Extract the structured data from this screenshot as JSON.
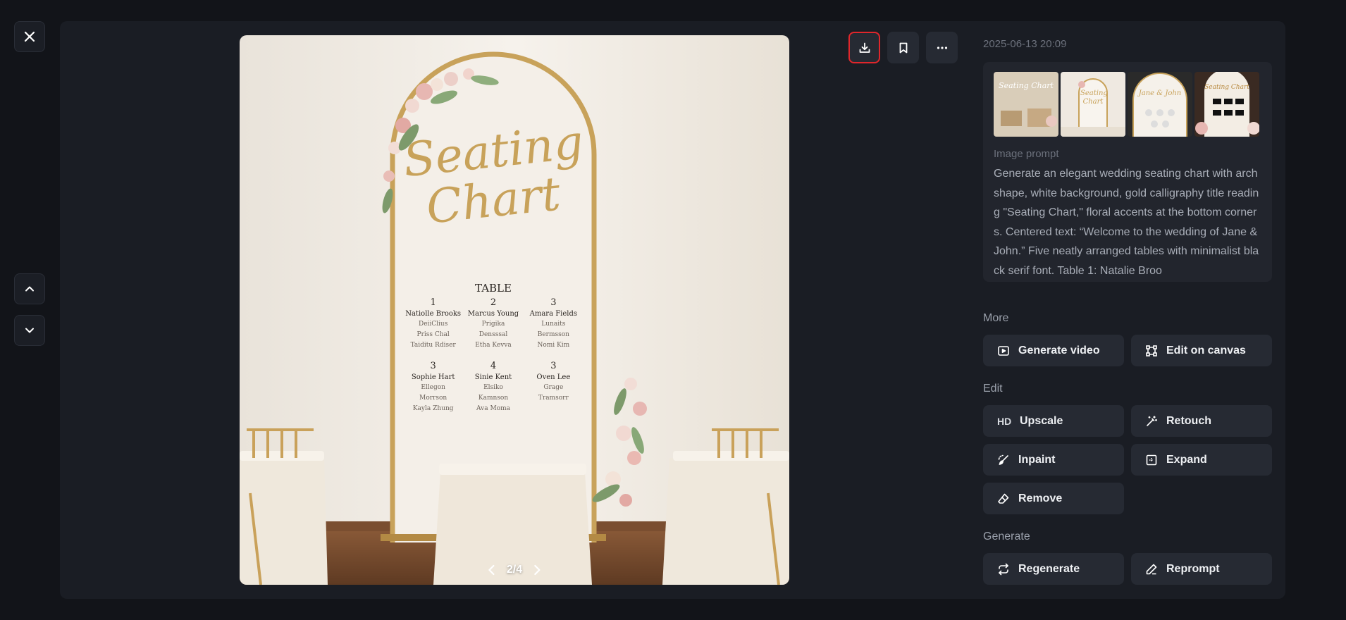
{
  "timestamp": "2025-06-13 20:09",
  "pager": {
    "text": "2/4"
  },
  "image": {
    "title_line1": "Seating",
    "title_line2": "Chart",
    "table_heading": "TABLE",
    "tables": [
      {
        "number": "1",
        "names": [
          "Natiolle Brooks",
          "DeiiClius",
          "Priss Chal",
          "Taiditu Rdiser"
        ]
      },
      {
        "number": "2",
        "names": [
          "Marcus Young",
          "Prigika",
          "Densssal",
          "Etha Kevva"
        ]
      },
      {
        "number": "3",
        "names": [
          "Amara Fields",
          "Lunaits",
          "Bermsson",
          "Nomi Kim"
        ]
      },
      {
        "number": "3",
        "names": [
          "Sophie Hart",
          "Ellegon",
          "Morrson",
          "Kayla Zhung"
        ]
      },
      {
        "number": "4",
        "names": [
          "Sinie Kent",
          "Elsiko",
          "Kamnson",
          "Ava Moma"
        ]
      },
      {
        "number": "3",
        "names": [
          "Oven Lee",
          "Grage",
          "Tramsorr"
        ]
      }
    ]
  },
  "thumbnails": [
    {
      "caption": "Seating Chart"
    },
    {
      "caption": "Seating Chart"
    },
    {
      "caption": "Jane & John"
    },
    {
      "caption": "Seating Chart"
    }
  ],
  "prompt": {
    "label": "Image prompt",
    "text": "Generate an elegant wedding seating chart with arch shape, white background, gold calligraphy title reading \"Seating Chart,\" floral accents at the bottom corners. Centered text: “Welcome to the wedding of Jane & John.” Five neatly arranged tables with minimalist black serif font. Table 1: Natalie Broo"
  },
  "sections": {
    "more": "More",
    "edit": "Edit",
    "generate": "Generate"
  },
  "actions": {
    "generate_video": "Generate video",
    "edit_on_canvas": "Edit on canvas",
    "upscale": "Upscale",
    "upscale_badge": "HD",
    "retouch": "Retouch",
    "inpaint": "Inpaint",
    "expand": "Expand",
    "remove": "Remove",
    "regenerate": "Regenerate",
    "reprompt": "Reprompt"
  },
  "colors": {
    "highlight": "#e0262b",
    "panel": "#1a1d24",
    "button": "#262a33",
    "gold": "#c8a25a"
  }
}
